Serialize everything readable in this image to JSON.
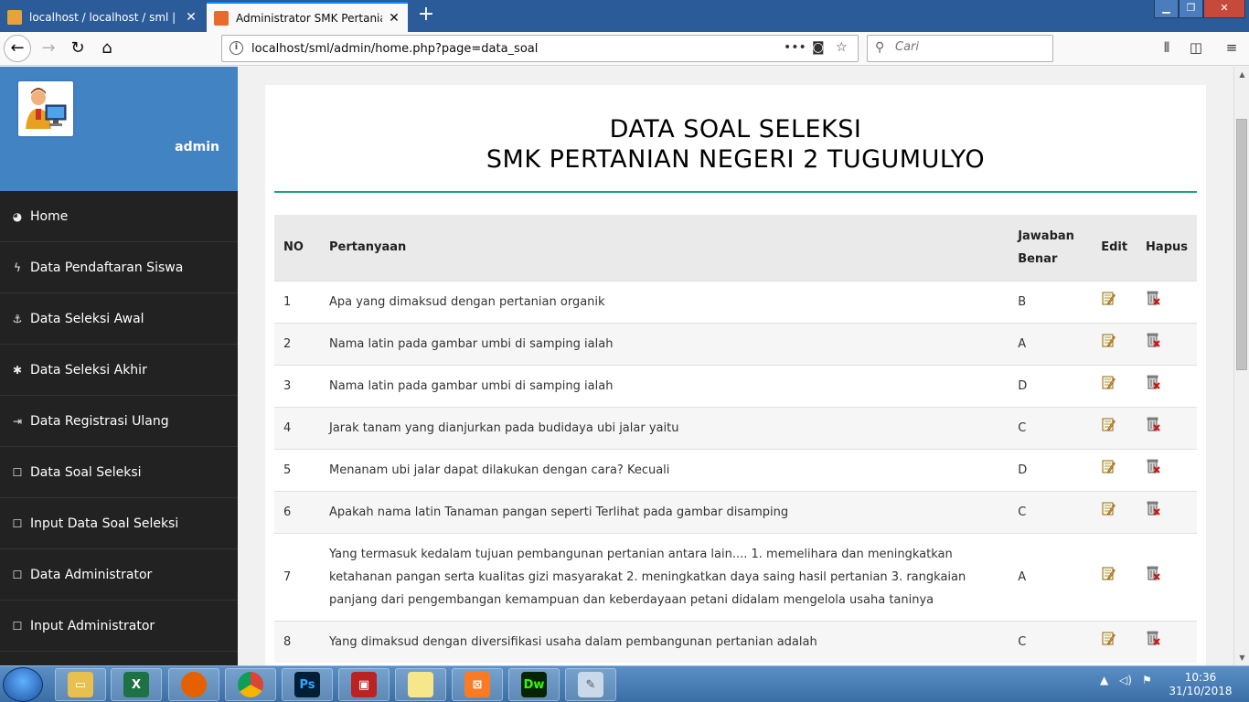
{
  "browser": {
    "tabs": [
      {
        "title": "localhost / localhost / sml | php"
      },
      {
        "title": "Administrator SMK Pertanian N"
      }
    ],
    "url": "localhost/sml/admin/home.php?page=data_soal",
    "search_placeholder": "Cari"
  },
  "sidebar": {
    "username": "admin",
    "items": [
      {
        "label": "Home",
        "icon": "dashboard-icon"
      },
      {
        "label": "Data Pendaftaran Siswa",
        "icon": "bolt-icon"
      },
      {
        "label": "Data Seleksi Awal",
        "icon": "anchor-icon"
      },
      {
        "label": "Data Seleksi Akhir",
        "icon": "bug-icon"
      },
      {
        "label": "Data Registrasi Ulang",
        "icon": "sign-in-icon"
      },
      {
        "label": "Data Soal Seleksi",
        "icon": "square-icon"
      },
      {
        "label": "Input Data Soal Seleksi",
        "icon": "square-icon"
      },
      {
        "label": "Data Administrator",
        "icon": "square-icon"
      },
      {
        "label": "Input Administrator",
        "icon": "square-icon"
      }
    ]
  },
  "page": {
    "title_line1": "DATA SOAL SELEKSI",
    "title_line2": "SMK PERTANIAN NEGERI 2 TUGUMULYO"
  },
  "table": {
    "headers": {
      "no": "NO",
      "question": "Pertanyaan",
      "answer_line1": "Jawaban",
      "answer_line2": "Benar",
      "edit": "Edit",
      "delete": "Hapus"
    },
    "rows": [
      {
        "no": "1",
        "question": "Apa yang dimaksud dengan pertanian organik",
        "answer": "B"
      },
      {
        "no": "2",
        "question": "Nama latin pada gambar umbi di samping ialah",
        "answer": "A"
      },
      {
        "no": "3",
        "question": "Nama latin pada gambar umbi di samping ialah",
        "answer": "D"
      },
      {
        "no": "4",
        "question": "Jarak tanam yang dianjurkan pada budidaya ubi jalar yaitu",
        "answer": "C"
      },
      {
        "no": "5",
        "question": "Menanam ubi jalar dapat dilakukan dengan cara? Kecuali",
        "answer": "D"
      },
      {
        "no": "6",
        "question": "Apakah nama latin Tanaman pangan seperti Terlihat pada gambar disamping",
        "answer": "C"
      },
      {
        "no": "7",
        "question": "Yang termasuk kedalam tujuan pembangunan pertanian antara lain.... 1. memelihara dan meningkatkan ketahanan pangan serta kualitas gizi masyarakat 2. meningkatkan daya saing hasil pertanian 3. rangkaian panjang dari pengembangan kemampuan dan keberdayaan petani didalam mengelola usaha taninya",
        "answer": "A"
      },
      {
        "no": "8",
        "question": "Yang dimaksud dengan diversifikasi usaha dalam pembangunan pertanian adalah",
        "answer": "C"
      }
    ]
  },
  "taskbar": {
    "apps": [
      "Explorer",
      "Excel",
      "Firefox",
      "Chrome",
      "Photoshop",
      "WinRAR",
      "Sticky Notes",
      "XAMPP",
      "Dreamweaver",
      "Paint"
    ],
    "photoshop_label": "Ps",
    "dreamweaver_label": "Dw",
    "time": "10:36",
    "date": "31/10/2018"
  },
  "colors": {
    "tab_strip": "#2b5b98",
    "sidebar_header": "#4283c4",
    "sidebar_bg": "#222222",
    "title_rule": "#1fa37f"
  }
}
